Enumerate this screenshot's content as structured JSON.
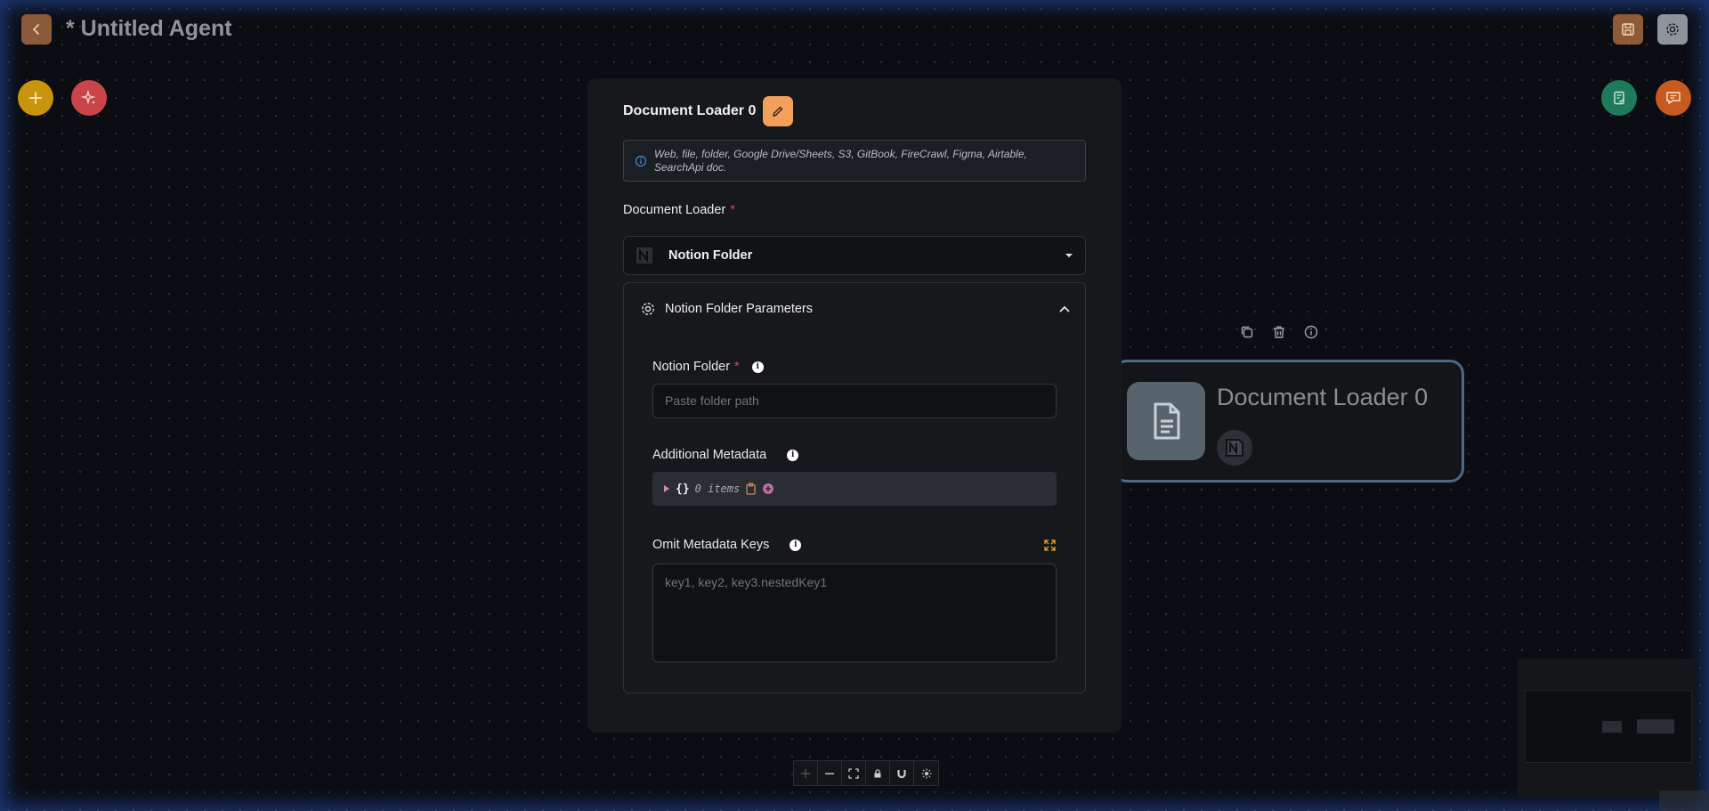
{
  "header": {
    "title": "* Untitled Agent"
  },
  "dialog": {
    "title": "Document Loader 0",
    "description": "Web, file, folder, Google Drive/Sheets, S3, GitBook, FireCrawl, Figma, Airtable, SearchApi doc.",
    "document_loader_label": "Document Loader",
    "required_mark": "*",
    "selected_loader": "Notion Folder",
    "params": {
      "title": "Notion Folder Parameters",
      "notion_folder_label": "Notion Folder",
      "notion_folder_placeholder": "Paste folder path",
      "additional_metadata_label": "Additional Metadata",
      "metadata_brace": "{}",
      "metadata_count": "0 items",
      "omit_keys_label": "Omit Metadata Keys",
      "omit_keys_placeholder": "key1, key2, key3.nestedKey1"
    }
  },
  "node": {
    "title": "Document Loader 0"
  },
  "colors": {
    "accent_orange": "#f3a05a",
    "required_red": "#e0484f",
    "node_border": "#4a6a84"
  }
}
